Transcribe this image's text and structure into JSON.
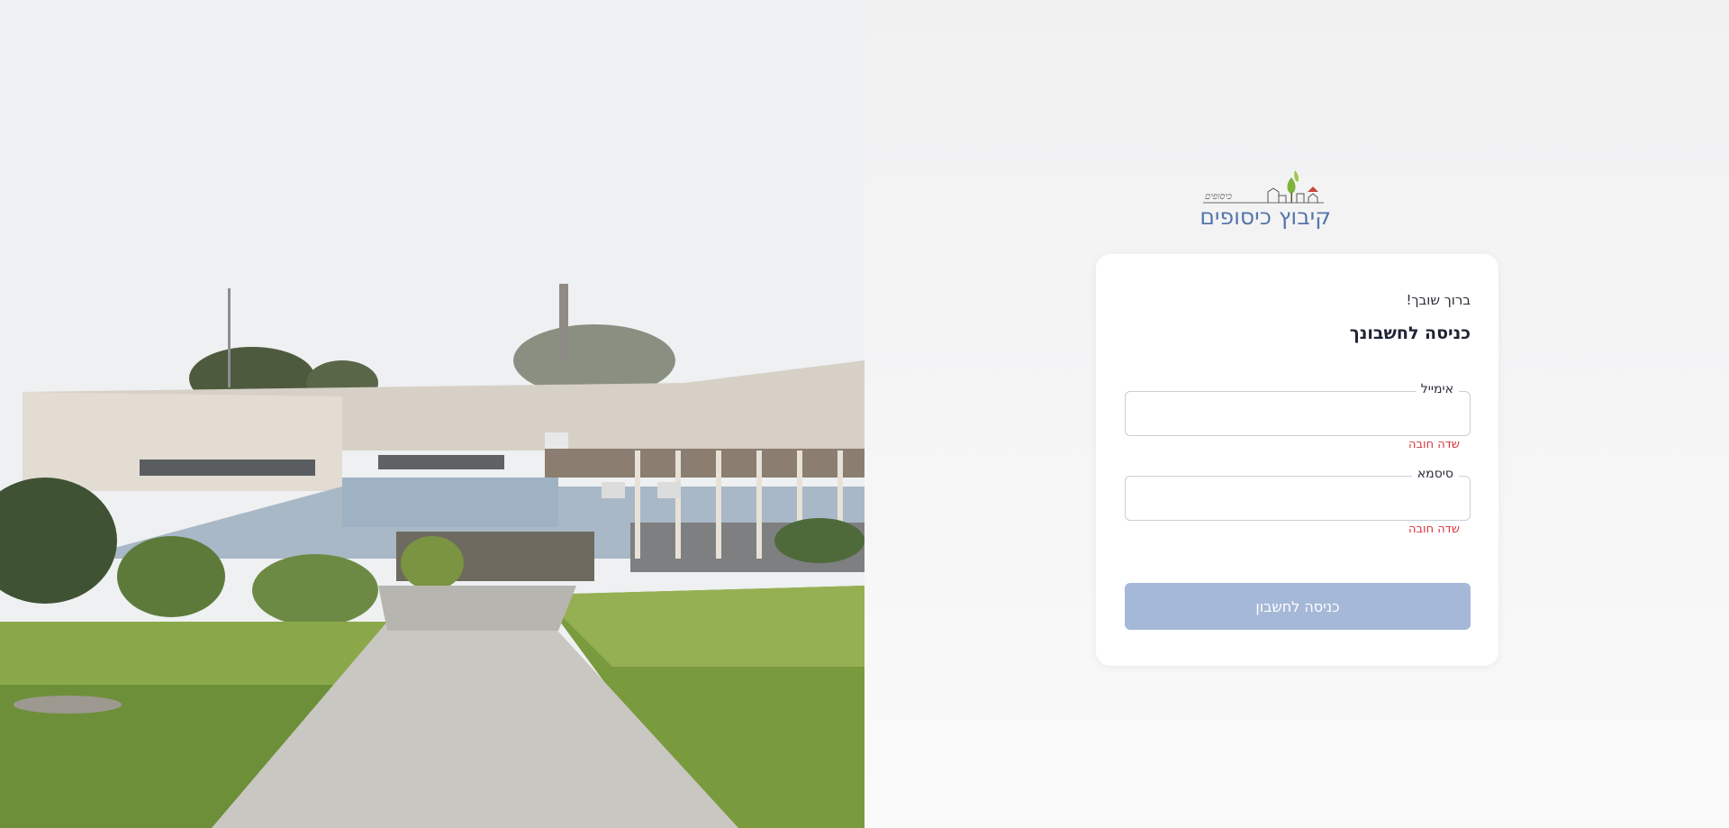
{
  "brand": {
    "name": "קיבוץ כיסופים",
    "tagline": "כיסופים"
  },
  "login": {
    "welcome": "ברוך שובך!",
    "title": "כניסה לחשבונך",
    "email_label": "אימייל",
    "email_value": "",
    "email_error": "שדה חובה",
    "password_label": "סיסמא",
    "password_value": "",
    "password_error": "שדה חובה",
    "submit_label": "כניסה לחשבון"
  },
  "colors": {
    "brand_blue": "#5577aa",
    "button_disabled": "#a5b8d8",
    "error_red": "#d9363e"
  },
  "icons": {
    "logo": "kibbutz-logo-icon",
    "photo": "campus-building-photo"
  }
}
